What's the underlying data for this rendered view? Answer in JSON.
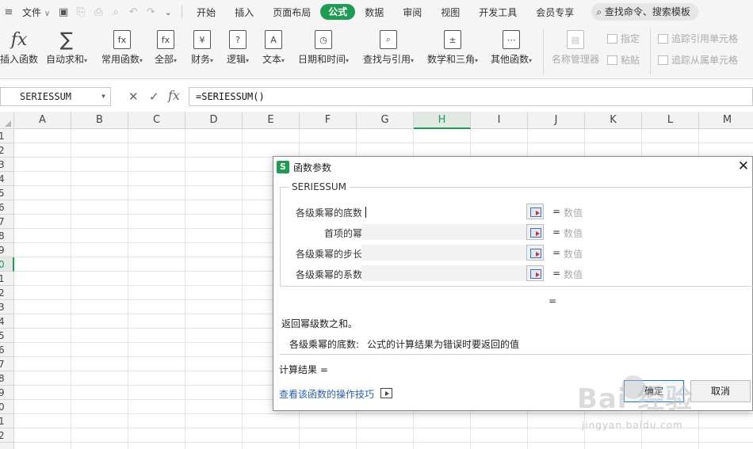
{
  "menubar": {
    "file_label": "文件",
    "file_caret": "∨",
    "more_caret": "⌄",
    "tabs": [
      "开始",
      "插入",
      "页面布局",
      "公式",
      "数据",
      "审阅",
      "视图",
      "开发工具",
      "会员专享"
    ],
    "active_tab": "公式",
    "search_label": "查找命令、搜索模板"
  },
  "ribbon": {
    "insert_function": "插入函数",
    "autosum": "自动求和",
    "common_functions": "常用函数",
    "all": "全部",
    "finance": "财务",
    "logic": "逻辑",
    "text": "文本",
    "datetime": "日期和时间",
    "lookup": "查找与引用",
    "math": "数学和三角",
    "other": "其他函数",
    "name_manager": "名称管理器",
    "define": "指定",
    "paste": "粘贴",
    "trace_precedents": "追踪引用单元格",
    "trace_dependents": "追踪从属单元格",
    "caret": "▾"
  },
  "formula_bar": {
    "name_box": "SERIESSUM",
    "cancel": "✕",
    "confirm": "✓",
    "fx": "fx",
    "formula": "=SERIESSUM()"
  },
  "grid": {
    "columns": [
      "A",
      "B",
      "C",
      "D",
      "E",
      "F",
      "G",
      "H",
      "I",
      "J",
      "K",
      "L",
      "M"
    ],
    "selected_column": "H",
    "rows": [
      "1",
      "2",
      "3",
      "4",
      "5",
      "6",
      "7",
      "8",
      "9",
      "0",
      "1",
      "2",
      "3",
      "4",
      "5",
      "6",
      "7",
      "8",
      "9",
      "0",
      "1",
      "2"
    ],
    "selected_row_index": 9
  },
  "dialog": {
    "logo": "S",
    "title": "函数参数",
    "close": "✕",
    "function_name": "SERIESSUM",
    "args": [
      {
        "label": "各级乘幂的底数",
        "eq": "=",
        "value": "数值"
      },
      {
        "label": "首项的幂",
        "eq": "=",
        "value": "数值"
      },
      {
        "label": "各级乘幂的步长",
        "eq": "=",
        "value": "数值"
      },
      {
        "label": "各级乘幂的系数",
        "eq": "=",
        "value": "数值"
      }
    ],
    "result_eq": "=",
    "description": "返回幂级数之和。",
    "arg_desc_label": "各级乘幂的底数:",
    "arg_desc_text": "公式的计算结果为错误时要返回的值",
    "calc_result": "计算结果 =",
    "howto_link": "查看该函数的操作技巧",
    "ok": "确定",
    "cancel": "取消"
  },
  "watermark": {
    "main": "Bai  经验",
    "sub": "jingyan.baidu.com"
  }
}
